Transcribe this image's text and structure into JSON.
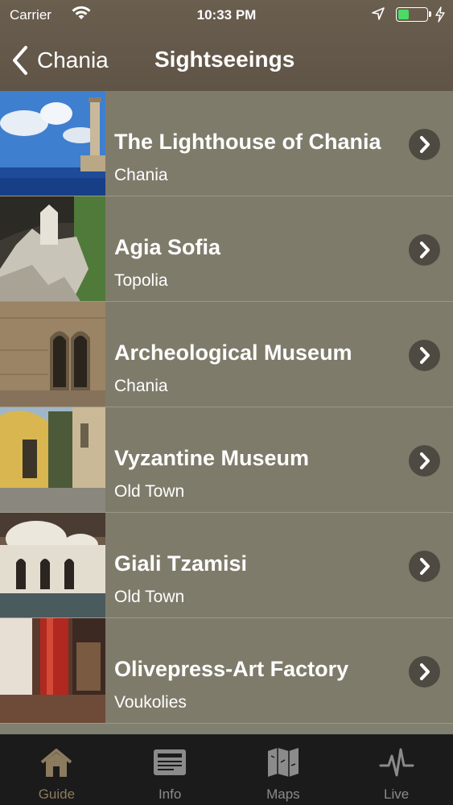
{
  "status_bar": {
    "carrier": "Carrier",
    "time": "10:33 PM",
    "battery_level": 0.4
  },
  "nav": {
    "back_label": "Chania",
    "title": "Sightseeings"
  },
  "items": [
    {
      "name": "The Lighthouse of Chania",
      "location": "Chania"
    },
    {
      "name": "Agia Sofia",
      "location": "Topolia"
    },
    {
      "name": "Archeological Museum",
      "location": "Chania"
    },
    {
      "name": "Vyzantine Museum",
      "location": "Old Town"
    },
    {
      "name": "Giali Tzamisi",
      "location": "Old Town"
    },
    {
      "name": "Olivepress-Art Factory",
      "location": "Voukolies"
    }
  ],
  "tabs": [
    {
      "label": "Guide",
      "icon": "home-icon",
      "active": true
    },
    {
      "label": "Info",
      "icon": "newspaper-icon",
      "active": false
    },
    {
      "label": "Maps",
      "icon": "map-icon",
      "active": false
    },
    {
      "label": "Live",
      "icon": "pulse-icon",
      "active": false
    }
  ],
  "colors": {
    "header": "#655a4b",
    "row": "#7f7b6b",
    "tab_active": "#8c7b5e",
    "tab_inactive": "#8b8b8b"
  }
}
